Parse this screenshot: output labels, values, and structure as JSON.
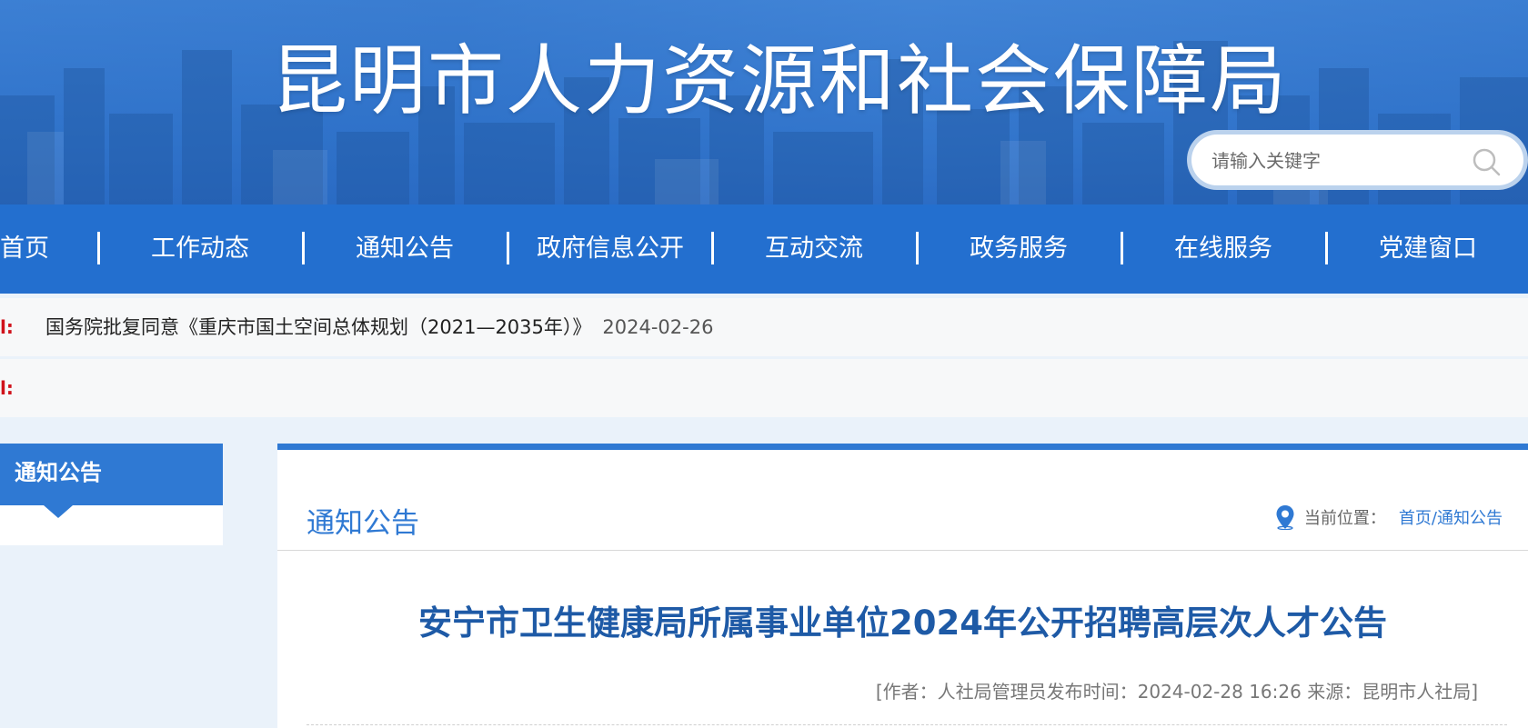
{
  "header": {
    "site_title": "昆明市人力资源和社会保障局",
    "search_placeholder": "请输入关键字"
  },
  "nav": {
    "items": [
      {
        "label": "首页"
      },
      {
        "label": "工作动态"
      },
      {
        "label": "通知公告"
      },
      {
        "label": "政府信息公开"
      },
      {
        "label": "互动交流"
      },
      {
        "label": "政务服务"
      },
      {
        "label": "在线服务"
      },
      {
        "label": "党建窗口"
      }
    ]
  },
  "notices": [
    {
      "label": "l:",
      "text": "国务院批复同意《重庆市国土空间总体规划（2021—2035年）》",
      "date": "2024-02-26"
    },
    {
      "label": "l:",
      "text": "",
      "date": ""
    }
  ],
  "sidebar": {
    "heading": "通知公告"
  },
  "main": {
    "section_title": "通知公告",
    "location_label": "当前位置：",
    "location_path": "首页/通知公告",
    "article_title": "安宁市卫生健康局所属事业单位2024年公开招聘高层次人才公告",
    "article_meta": "[作者：人社局管理员发布时间：2024-02-28 16:26 来源：昆明市人社局]"
  },
  "colors": {
    "nav_bg": "#236fcf",
    "accent": "#2f79d3",
    "article_title": "#1e5aa6",
    "notice_label": "#d0121b"
  }
}
